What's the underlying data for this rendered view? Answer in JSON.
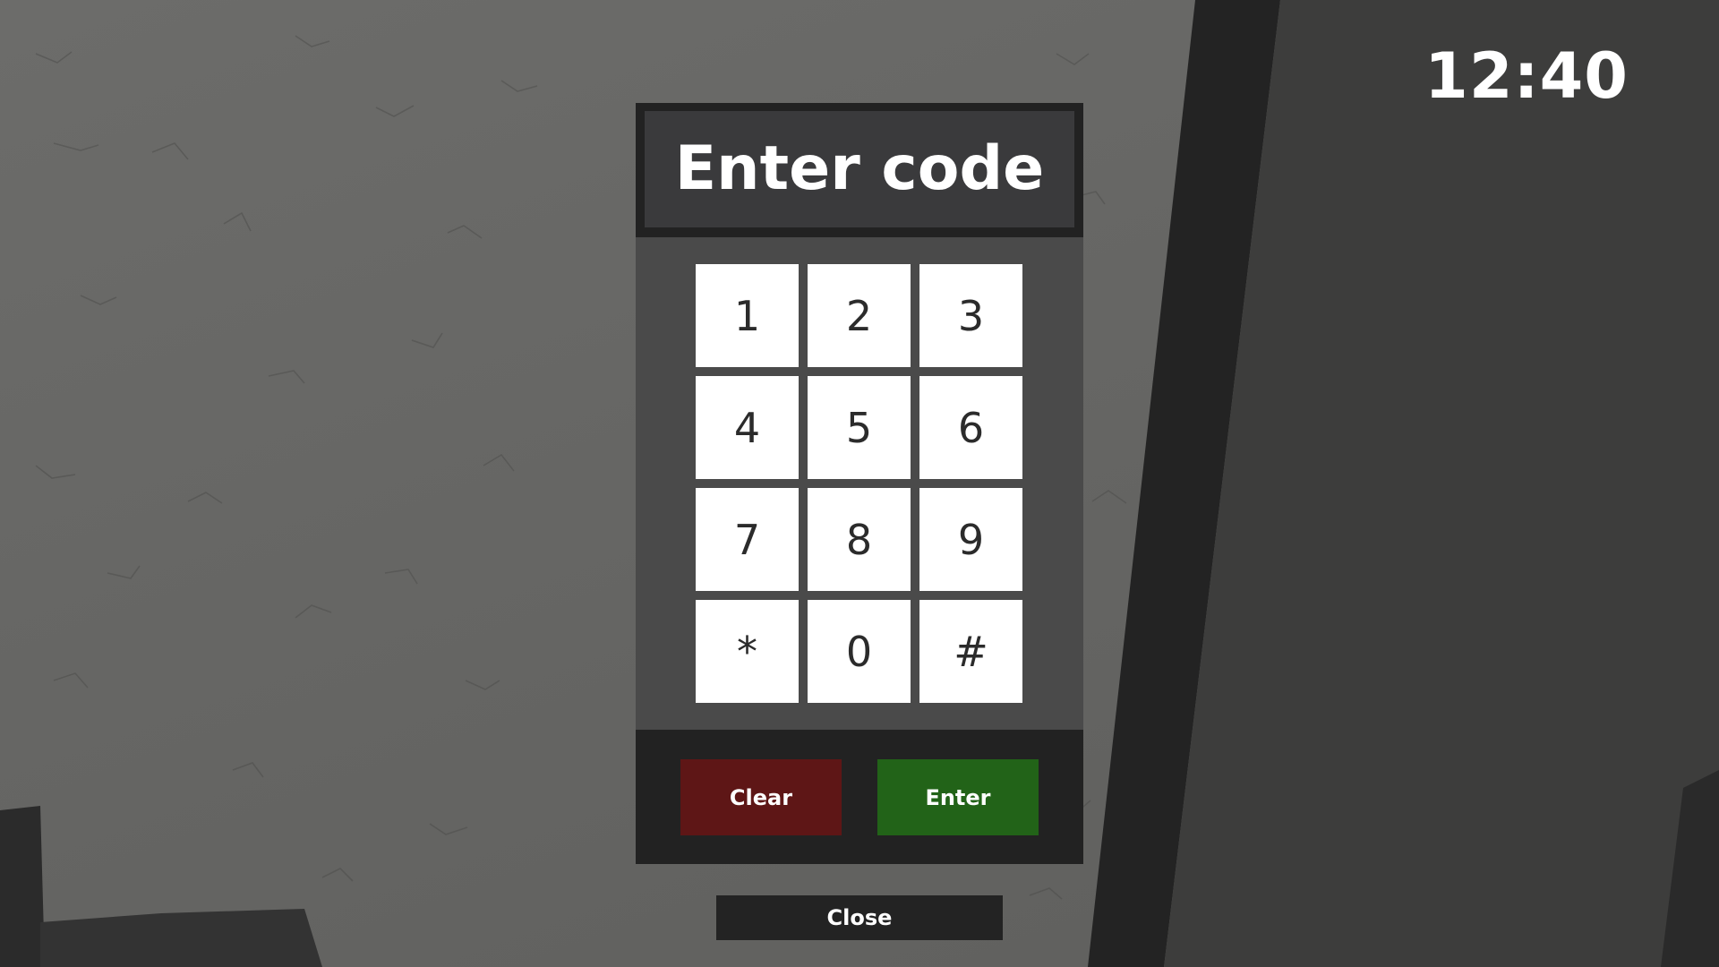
{
  "hud": {
    "clock": "12:40"
  },
  "dialog": {
    "title": "Enter code",
    "keys": [
      "1",
      "2",
      "3",
      "4",
      "5",
      "6",
      "7",
      "8",
      "9",
      "*",
      "0",
      "#"
    ],
    "clear_label": "Clear",
    "enter_label": "Enter"
  },
  "close_label": "Close",
  "colors": {
    "clear_button": "#5e1616",
    "enter_button": "#226318",
    "dialog_background": "#222222",
    "keys_panel": "#4a4a4a",
    "title_bar": "#3a3a3c"
  }
}
